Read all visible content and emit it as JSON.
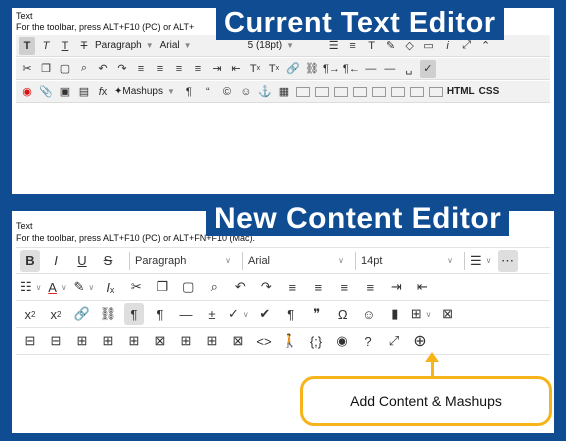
{
  "current": {
    "label": "Text",
    "instructions": "For the toolbar, press ALT+F10 (PC) or ALT+",
    "banner": "Current Text Editor",
    "row1": {
      "paragraph": "Paragraph",
      "font": "Arial",
      "size": "5 (18pt)"
    },
    "row3": {
      "mashups": "Mashups",
      "html": "HTML",
      "css": "CSS"
    }
  },
  "new_editor": {
    "label": "Text",
    "instructions": "For the toolbar, press ALT+F10 (PC) or ALT+FN+F10 (Mac).",
    "banner": "New Content Editor",
    "row1": {
      "paragraph": "Paragraph",
      "font": "Arial",
      "size": "14pt"
    }
  },
  "callout": {
    "text": "Add Content & Mashups"
  },
  "colors": {
    "background": "#0f4c92",
    "callout_border": "#f6b41a"
  }
}
